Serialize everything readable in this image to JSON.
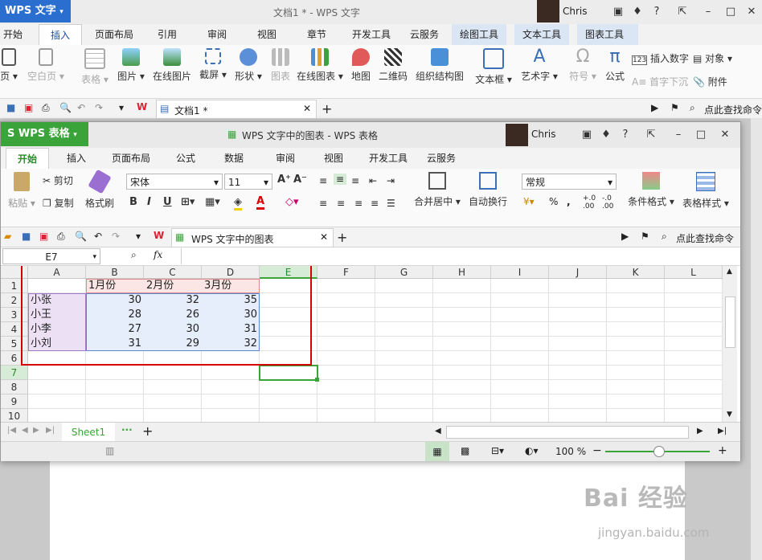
{
  "writer": {
    "brand": "WPS 文字",
    "title": "文档1 * - WPS 文字",
    "user": "Chris",
    "tabs": [
      "开始",
      "插入",
      "页面布局",
      "引用",
      "审阅",
      "视图",
      "章节",
      "开发工具",
      "云服务",
      "绘图工具",
      "文本工具",
      "图表工具"
    ],
    "active_tab": "插入",
    "ribbon": [
      {
        "label": "页 ▾",
        "icon": "page-icon",
        "dim": false
      },
      {
        "label": "空白页 ▾",
        "icon": "blank-page-icon",
        "dim": true
      },
      {
        "label": "表格 ▾",
        "icon": "table-icon",
        "dim": true
      },
      {
        "label": "图片 ▾",
        "icon": "picture-icon",
        "dim": false
      },
      {
        "label": "在线图片",
        "icon": "online-picture-icon",
        "dim": false
      },
      {
        "label": "截屏 ▾",
        "icon": "screenshot-icon",
        "dim": false
      },
      {
        "label": "形状 ▾",
        "icon": "shape-icon",
        "dim": false
      },
      {
        "label": "图表",
        "icon": "chart-icon",
        "dim": true
      },
      {
        "label": "在线图表 ▾",
        "icon": "online-chart-icon",
        "dim": false
      },
      {
        "label": "地图",
        "icon": "map-icon",
        "dim": false
      },
      {
        "label": "二维码",
        "icon": "qrcode-icon",
        "dim": false
      },
      {
        "label": "组织结构图",
        "icon": "org-chart-icon",
        "dim": false
      },
      {
        "label": "文本框 ▾",
        "icon": "textbox-icon",
        "dim": false
      },
      {
        "label": "艺术字 ▾",
        "icon": "wordart-icon",
        "dim": false
      },
      {
        "label": "符号 ▾",
        "icon": "symbol-icon",
        "dim": true
      },
      {
        "label": "公式",
        "icon": "formula-icon",
        "dim": false
      }
    ],
    "ribbon_small": [
      "插入数字",
      "对象 ▾",
      "首字下沉",
      "附件"
    ],
    "doc_tab": "文档1 *",
    "search": "点此查找命令",
    "watermark": "Bai 经验",
    "watermark_url": "jingyan.baidu.com"
  },
  "sheet": {
    "brand": "WPS 表格",
    "title": "WPS 文字中的图表 - WPS 表格",
    "user": "Chris",
    "tabs": [
      "开始",
      "插入",
      "页面布局",
      "公式",
      "数据",
      "审阅",
      "视图",
      "开发工具",
      "云服务"
    ],
    "active_tab": "开始",
    "ribbon": {
      "paste": "粘贴 ▾",
      "cut": "剪切",
      "copy": "复制",
      "format_painter": "格式刷",
      "font_name": "宋体",
      "font_size": "11",
      "merge": "合并居中 ▾",
      "wrap": "自动换行",
      "number_format": "常规",
      "percent": "%",
      "cond_format": "条件格式 ▾",
      "table_style": "表格样式 ▾"
    },
    "doc_tab": "WPS 文字中的图表",
    "search": "点此查找命令",
    "name_box": "E7",
    "fx": "fx",
    "columns": [
      "A",
      "B",
      "C",
      "D",
      "E",
      "F",
      "G",
      "H",
      "I",
      "J",
      "K",
      "L"
    ],
    "rows": [
      "1",
      "2",
      "3",
      "4",
      "5",
      "6",
      "7",
      "8",
      "9",
      "10"
    ],
    "selected_cell": "E7",
    "table": {
      "headers": [
        "",
        "1月份",
        "2月份",
        "3月份"
      ],
      "data": [
        [
          "小张",
          "30",
          "32",
          "35"
        ],
        [
          "小王",
          "28",
          "26",
          "30"
        ],
        [
          "小李",
          "27",
          "30",
          "31"
        ],
        [
          "小刘",
          "31",
          "29",
          "32"
        ]
      ]
    },
    "sheet_tab": "Sheet1",
    "zoom": "100 %",
    "colors": {
      "accent": "#3aa339",
      "selection_box": "#d40000"
    }
  }
}
